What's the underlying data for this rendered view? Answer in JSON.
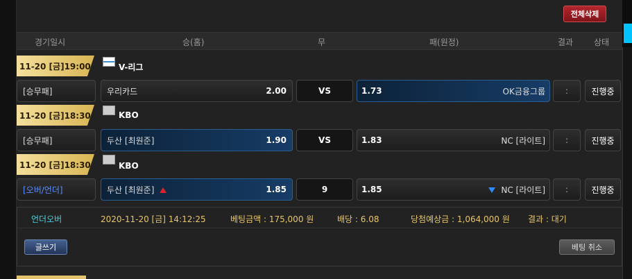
{
  "toolbar": {
    "delete_all_label": "전체삭제"
  },
  "header": {
    "col_datetime": "경기일시",
    "col_home": "승(홈)",
    "col_draw": "무",
    "col_away": "패(원정)",
    "col_result": "결과",
    "col_status": "상태"
  },
  "matches": [
    {
      "datetime": "11-20 [금]19:00",
      "league": "V-리그",
      "league_icon": "volleyball-league-icon",
      "bet_type": "[승무패]",
      "home_team": "우리카드",
      "home_odds": "2.00",
      "middle": "VS",
      "away_odds": "1.73",
      "away_team": "OK금융그룹",
      "result": ":",
      "status": "진행중"
    },
    {
      "datetime": "11-20 [금]18:30",
      "league": "KBO",
      "league_icon": "baseball-league-icon",
      "bet_type": "[승무패]",
      "home_team": "두산 [최원준]",
      "home_odds": "1.90",
      "middle": "VS",
      "away_odds": "1.83",
      "away_team": "NC [라이트]",
      "result": ":",
      "status": "진행중"
    },
    {
      "datetime": "11-20 [금]18:30",
      "league": "KBO",
      "league_icon": "baseball-league-icon",
      "bet_type": "[오버/언더]",
      "home_team": "두산 [최원준]",
      "home_odds": "1.85",
      "middle": "9",
      "away_odds": "1.85",
      "away_team": "NC [라이트]",
      "result": ":",
      "status": "진행중"
    }
  ],
  "summary": {
    "type": "언더오버",
    "datetime": "2020-11-20 [금] 14:12:25",
    "bet_amount": "베팅금액 : 175,000 원",
    "odds": "배당 : 6.08",
    "expected_win": "당첨예상금 : 1,064,000 원",
    "result": "결과 : 대기",
    "write_label": "글쓰기",
    "cancel_label": "베팅 취소"
  },
  "colors": {
    "accent_gold": "#e2c26b",
    "delete_red": "#9e1c22",
    "selected_blue": "#173c66",
    "summary_cyan": "#4dd0e1",
    "summary_gold": "#e8c66a"
  }
}
